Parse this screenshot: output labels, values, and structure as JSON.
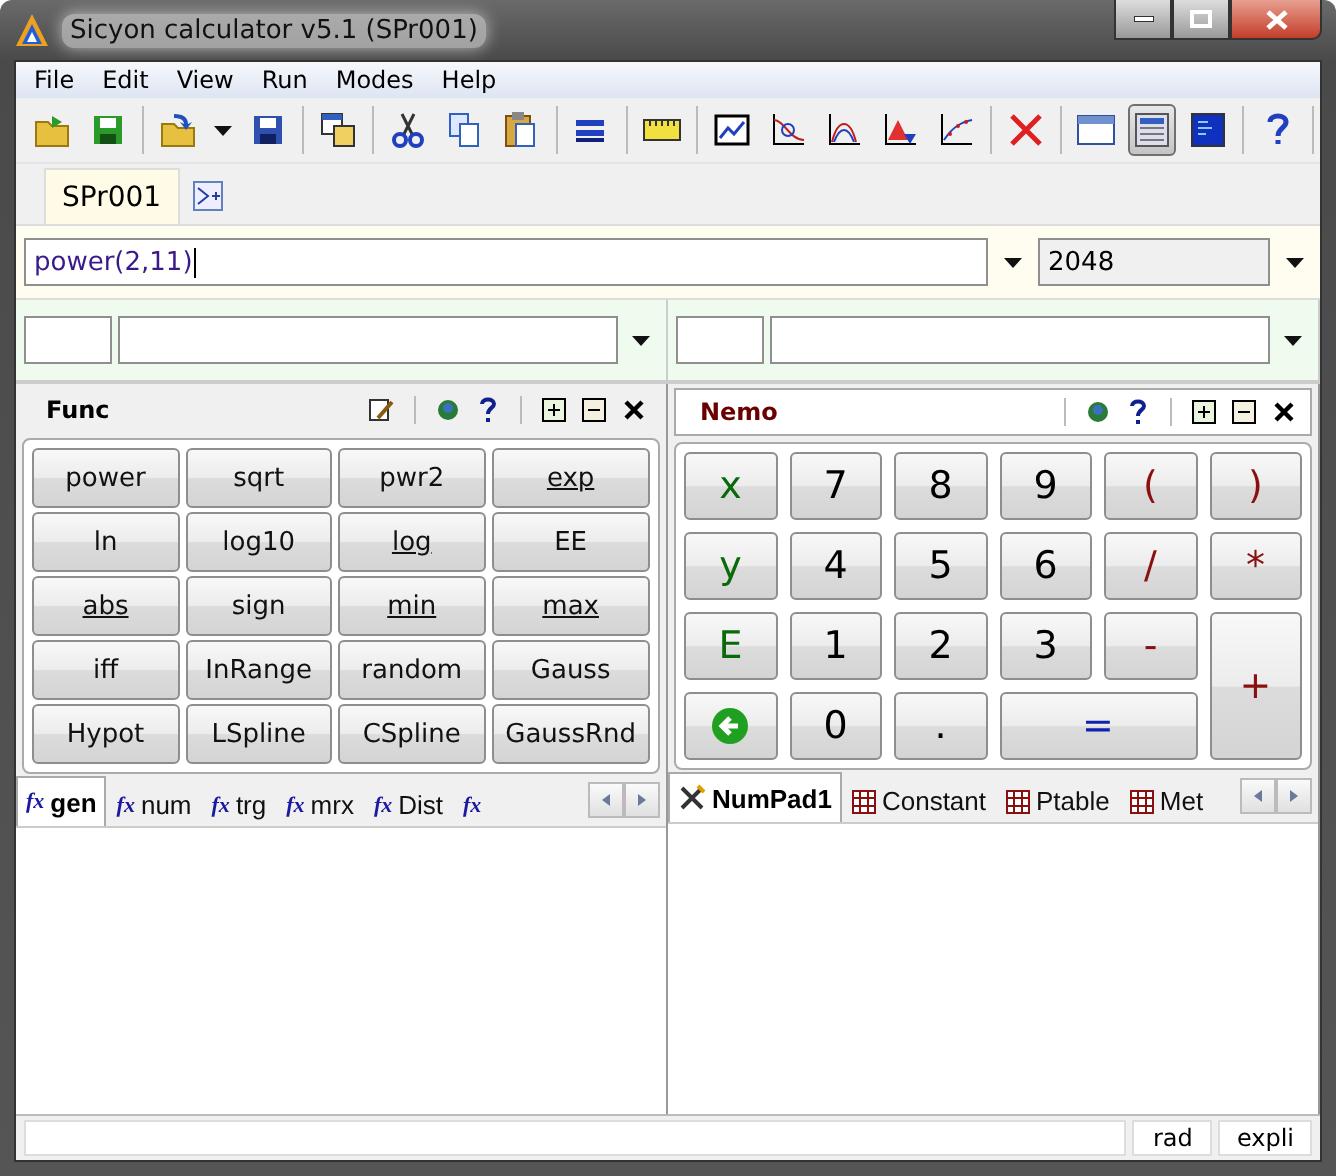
{
  "window": {
    "title": "Sicyon calculator v5.1 (SPr001)"
  },
  "menu": [
    "File",
    "Edit",
    "View",
    "Run",
    "Modes",
    "Help"
  ],
  "toolbar": [
    {
      "selected": false
    },
    {
      "selected": false
    },
    {
      "selected": false
    },
    {
      "selected": false
    },
    {
      "selected": false
    },
    {
      "selected": false
    },
    {
      "selected": false
    },
    {
      "selected": false
    },
    {
      "selected": false
    },
    {
      "selected": false
    },
    {
      "selected": false
    },
    {
      "selected": false
    },
    {
      "selected": false
    },
    {
      "selected": false
    },
    {
      "selected": false
    },
    {
      "selected": false
    },
    {
      "selected": false
    },
    {
      "selected": true
    },
    {
      "selected": false
    },
    {
      "selected": false
    }
  ],
  "document_tabs": [
    {
      "label": "SPr001",
      "selected": true
    }
  ],
  "expression": {
    "value": "power(2,11)",
    "result": "2048"
  },
  "left_panel": {
    "title": "Func",
    "buttons": [
      {
        "label": "power",
        "underlined": false
      },
      {
        "label": "sqrt",
        "underlined": false
      },
      {
        "label": "pwr2",
        "underlined": false
      },
      {
        "label": "exp",
        "underlined": true
      },
      {
        "label": "ln",
        "underlined": false
      },
      {
        "label": "log10",
        "underlined": false
      },
      {
        "label": "log",
        "underlined": true
      },
      {
        "label": "EE",
        "underlined": false
      },
      {
        "label": "abs",
        "underlined": true
      },
      {
        "label": "sign",
        "underlined": false
      },
      {
        "label": "min",
        "underlined": true
      },
      {
        "label": "max",
        "underlined": true
      },
      {
        "label": "iff",
        "underlined": false
      },
      {
        "label": "InRange",
        "underlined": false
      },
      {
        "label": "random",
        "underlined": false
      },
      {
        "label": "Gauss",
        "underlined": false
      },
      {
        "label": "Hypot",
        "underlined": false
      },
      {
        "label": "LSpline",
        "underlined": false
      },
      {
        "label": "CSpline",
        "underlined": false
      },
      {
        "label": "GaussRnd",
        "underlined": false
      }
    ],
    "tabs": [
      {
        "kind": "function",
        "icon_text": "fx",
        "label": "gen",
        "selected": true
      },
      {
        "kind": "function",
        "icon_text": "fx",
        "label": "num",
        "selected": false
      },
      {
        "kind": "function",
        "icon_text": "fx",
        "label": "trg",
        "selected": false
      },
      {
        "kind": "function",
        "icon_text": "fx",
        "label": "mrx",
        "selected": false
      },
      {
        "kind": "function",
        "icon_text": "fx",
        "label": "Dist",
        "selected": false
      },
      {
        "kind": "function",
        "icon_text": "fx",
        "selected": false
      }
    ]
  },
  "right_panel": {
    "title": "Nemo",
    "keys": [
      {
        "kind": "var",
        "label": "x"
      },
      {
        "kind": "digit",
        "label": "7"
      },
      {
        "kind": "digit",
        "label": "8"
      },
      {
        "kind": "digit",
        "label": "9"
      },
      {
        "kind": "op",
        "label": "("
      },
      {
        "kind": "op",
        "label": ")"
      },
      {
        "kind": "var",
        "label": "y"
      },
      {
        "kind": "digit",
        "label": "4"
      },
      {
        "kind": "digit",
        "label": "5"
      },
      {
        "kind": "digit",
        "label": "6"
      },
      {
        "kind": "op",
        "label": "/"
      },
      {
        "kind": "op",
        "label": "*"
      },
      {
        "kind": "var",
        "label": "E"
      },
      {
        "kind": "digit",
        "label": "1"
      },
      {
        "kind": "digit",
        "label": "2"
      },
      {
        "kind": "digit",
        "label": "3"
      },
      {
        "kind": "op",
        "label": "-"
      },
      {
        "kind": "op",
        "label": "+",
        "tall": true
      },
      {
        "kind": "back"
      },
      {
        "kind": "digit",
        "label": "0"
      },
      {
        "kind": "digit",
        "label": "."
      },
      {
        "kind": "equals",
        "label": "=",
        "wide": true
      }
    ],
    "tabs": [
      {
        "kind": "tools",
        "label": "NumPad1",
        "selected": true
      },
      {
        "kind": "table",
        "label": "Constant",
        "selected": false
      },
      {
        "kind": "table",
        "label": "Ptable",
        "selected": false
      },
      {
        "kind": "table",
        "label": "Met",
        "selected": false
      }
    ]
  },
  "status_bar": [
    "rad",
    "expli"
  ]
}
